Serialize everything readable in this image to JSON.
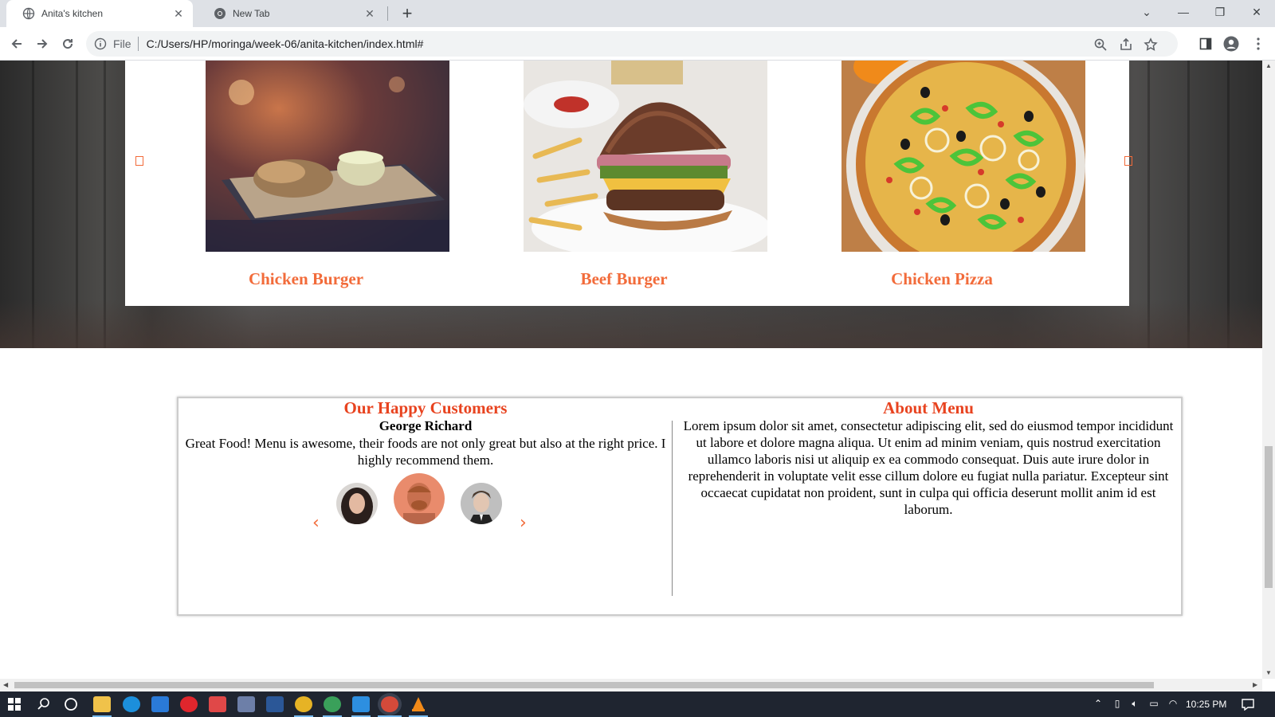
{
  "browser": {
    "tabs": [
      {
        "title": "Anita's kitchen",
        "icon": "globe-icon",
        "active": true
      },
      {
        "title": "New Tab",
        "icon": "chrome-icon",
        "active": false
      }
    ],
    "address": {
      "scheme_label": "File",
      "url": "C:/Users/HP/moringa/week-06/anita-kitchen/index.html#"
    }
  },
  "menu": {
    "items": [
      {
        "name": "Chicken Burger",
        "image": "chicken-burger-photo"
      },
      {
        "name": "Beef Burger",
        "image": "beef-burger-photo"
      },
      {
        "name": "Chicken Pizza",
        "image": "chicken-pizza-photo"
      }
    ]
  },
  "customers": {
    "heading": "Our Happy Customers",
    "name": "George Richard",
    "quote": "Great Food! Menu is awesome, their foods are not only great but also at the right price. I highly recommend them."
  },
  "about": {
    "heading": "About Menu",
    "text": "Lorem ipsum dolor sit amet, consectetur adipiscing elit, sed do eiusmod tempor incididunt ut labore et dolore magna aliqua. Ut enim ad minim veniam, quis nostrud exercitation ullamco laboris nisi ut aliquip ex ea commodo consequat. Duis aute irure dolor in reprehenderit in voluptate velit esse cillum dolore eu fugiat nulla pariatur. Excepteur sint occaecat cupidatat non proident, sunt in culpa qui officia deserunt mollit anim id est laborum."
  },
  "taskbar": {
    "clock": "10:25 PM"
  },
  "colors": {
    "accent": "#f26b3a",
    "heading": "#e8431f"
  }
}
